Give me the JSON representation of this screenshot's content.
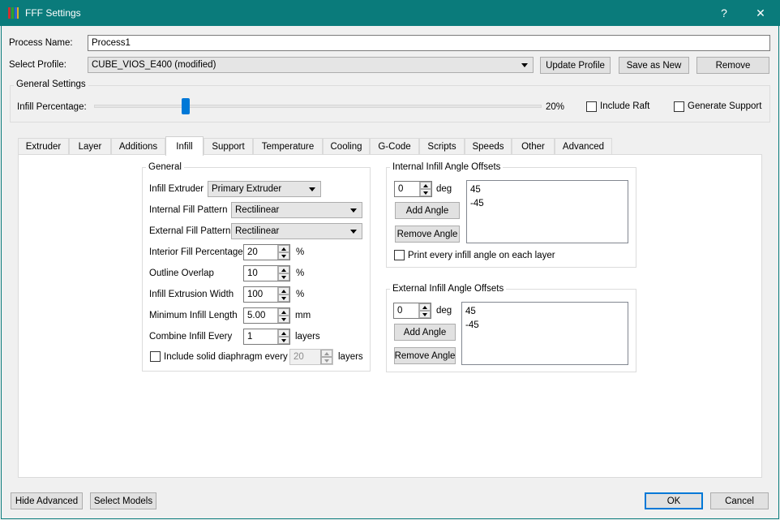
{
  "window": {
    "title": "FFF Settings",
    "help_glyph": "?",
    "close_glyph": "✕"
  },
  "process": {
    "label": "Process Name:",
    "value": "Process1"
  },
  "profile": {
    "label": "Select Profile:",
    "selected": "CUBE_VIOS_E400 (modified)",
    "update_label": "Update Profile",
    "save_new_label": "Save as New",
    "remove_label": "Remove"
  },
  "general_settings": {
    "title": "General Settings",
    "infill_label": "Infill Percentage:",
    "infill_value": "20%",
    "infill_fraction": 0.2,
    "include_raft_label": "Include Raft",
    "include_raft_checked": false,
    "generate_support_label": "Generate Support",
    "generate_support_checked": false
  },
  "tabs": [
    {
      "label": "Extruder"
    },
    {
      "label": "Layer"
    },
    {
      "label": "Additions"
    },
    {
      "label": "Infill",
      "active": true
    },
    {
      "label": "Support"
    },
    {
      "label": "Temperature"
    },
    {
      "label": "Cooling"
    },
    {
      "label": "G-Code"
    },
    {
      "label": "Scripts"
    },
    {
      "label": "Speeds"
    },
    {
      "label": "Other"
    },
    {
      "label": "Advanced"
    }
  ],
  "infill": {
    "general": {
      "title": "General",
      "extruder": {
        "label": "Infill Extruder",
        "value": "Primary Extruder"
      },
      "internal_pattern": {
        "label": "Internal Fill Pattern",
        "value": "Rectilinear"
      },
      "external_pattern": {
        "label": "External Fill Pattern",
        "value": "Rectilinear"
      },
      "interior_percentage": {
        "label": "Interior Fill Percentage",
        "value": "20",
        "unit": "%"
      },
      "outline_overlap": {
        "label": "Outline Overlap",
        "value": "10",
        "unit": "%"
      },
      "extrusion_width": {
        "label": "Infill Extrusion Width",
        "value": "100",
        "unit": "%"
      },
      "min_length": {
        "label": "Minimum Infill Length",
        "value": "5.00",
        "unit": "mm"
      },
      "combine_every": {
        "label": "Combine Infill Every",
        "value": "1",
        "unit": "layers"
      },
      "diaphragm": {
        "label": "Include solid diaphragm every",
        "checked": false,
        "value": "20",
        "unit": "layers"
      }
    },
    "internal_angles": {
      "title": "Internal Infill Angle Offsets",
      "input_value": "0",
      "unit": "deg",
      "add_label": "Add Angle",
      "remove_label": "Remove Angle",
      "angles": [
        "45",
        "-45"
      ],
      "print_every_label": "Print every infill angle on each layer",
      "print_every_checked": false
    },
    "external_angles": {
      "title": "External Infill Angle Offsets",
      "input_value": "0",
      "unit": "deg",
      "add_label": "Add Angle",
      "remove_label": "Remove Angle",
      "angles": [
        "45",
        "-45"
      ]
    }
  },
  "footer": {
    "hide_advanced_label": "Hide Advanced",
    "select_models_label": "Select Models",
    "ok_label": "OK",
    "cancel_label": "Cancel"
  },
  "colors": {
    "titlebar": "#0a7b7b",
    "accent": "#0078d7",
    "window_bg": "#f0f0f0"
  }
}
